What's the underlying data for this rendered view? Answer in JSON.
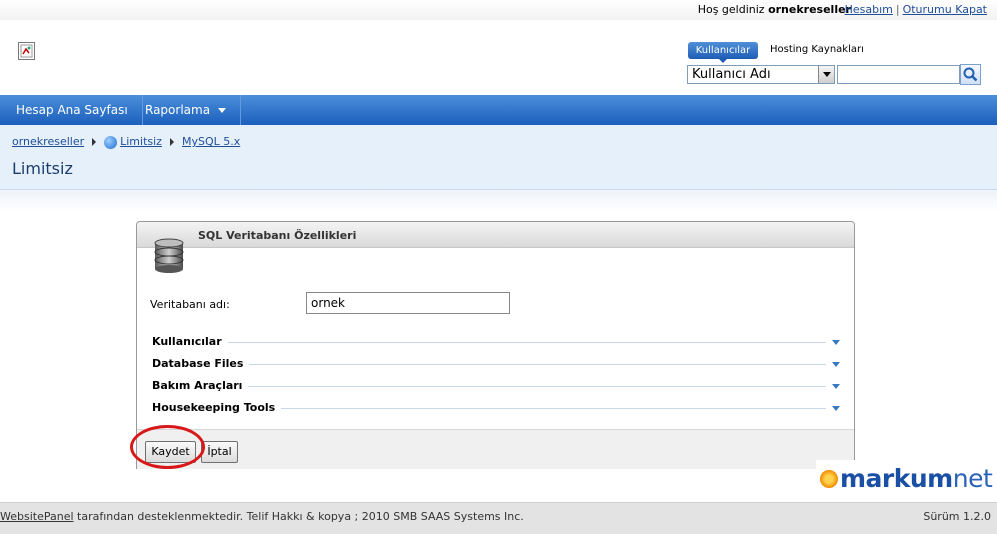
{
  "header": {
    "welcome_prefix": "Hoş geldiniz",
    "username": "ornekreseller",
    "link_account": "Hesabım",
    "link_logout": "Oturumu Kapat",
    "separator": "|"
  },
  "search": {
    "tabs": [
      "Kullanıcılar",
      "Hosting Kaynakları"
    ],
    "selected_field": "Kullanıcı Adı",
    "input_value": "",
    "icon": "search-icon"
  },
  "nav": {
    "items": [
      {
        "label": "Hesap Ana Sayfası"
      },
      {
        "label": "Raporlama"
      }
    ]
  },
  "breadcrumb": {
    "items": [
      "ornekreseller",
      "Limitsiz",
      "MySQL 5.x"
    ]
  },
  "page": {
    "title": "Limitsiz"
  },
  "panel": {
    "title": "SQL Veritabanı Özellikleri",
    "icon": "database-icon",
    "db_name_label": "Veritabanı adı:",
    "db_name_value": "ornek",
    "sections": [
      "Kullanıcılar",
      "Database Files",
      "Bakım Araçları",
      "Housekeeping Tools"
    ],
    "save_label": "Kaydet",
    "cancel_label": "İptal"
  },
  "watermark": {
    "brand": "markum",
    "suffix": "net"
  },
  "footer": {
    "link": "WebsitePanel",
    "text": " tarafından desteklenmektedir. Telif Hakkı & kopya ; 2010 SMB SAAS Systems Inc.",
    "version": "Sürüm 1.2.0"
  },
  "colors": {
    "nav_blue": "#1c5fbd",
    "title_blue": "#1b3e6f",
    "highlight_red": "#d81818"
  }
}
